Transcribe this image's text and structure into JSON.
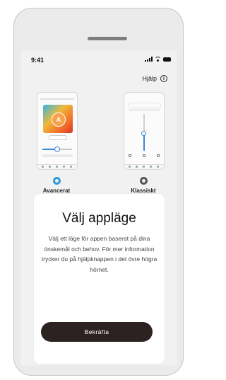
{
  "status_bar": {
    "time": "9:41"
  },
  "help": {
    "label": "Hjälp",
    "icon": "info-icon"
  },
  "previews": {
    "advanced": {
      "card_letter": "A"
    }
  },
  "options": [
    {
      "label": "Avancerat",
      "selected": true
    },
    {
      "label": "Klassiskt",
      "selected": false
    }
  ],
  "dialog": {
    "title": "Välj appläge",
    "body": "Välj ett läge för appen baserat på dina önskemål och behov. För mer information trycker du på hjälpknappen i det övre högra hörnet.",
    "confirm_label": "Bekräfta"
  },
  "colors": {
    "accent": "#2f9bd8",
    "button_bg": "#2b2221",
    "device_frame": "#ebebeb"
  }
}
